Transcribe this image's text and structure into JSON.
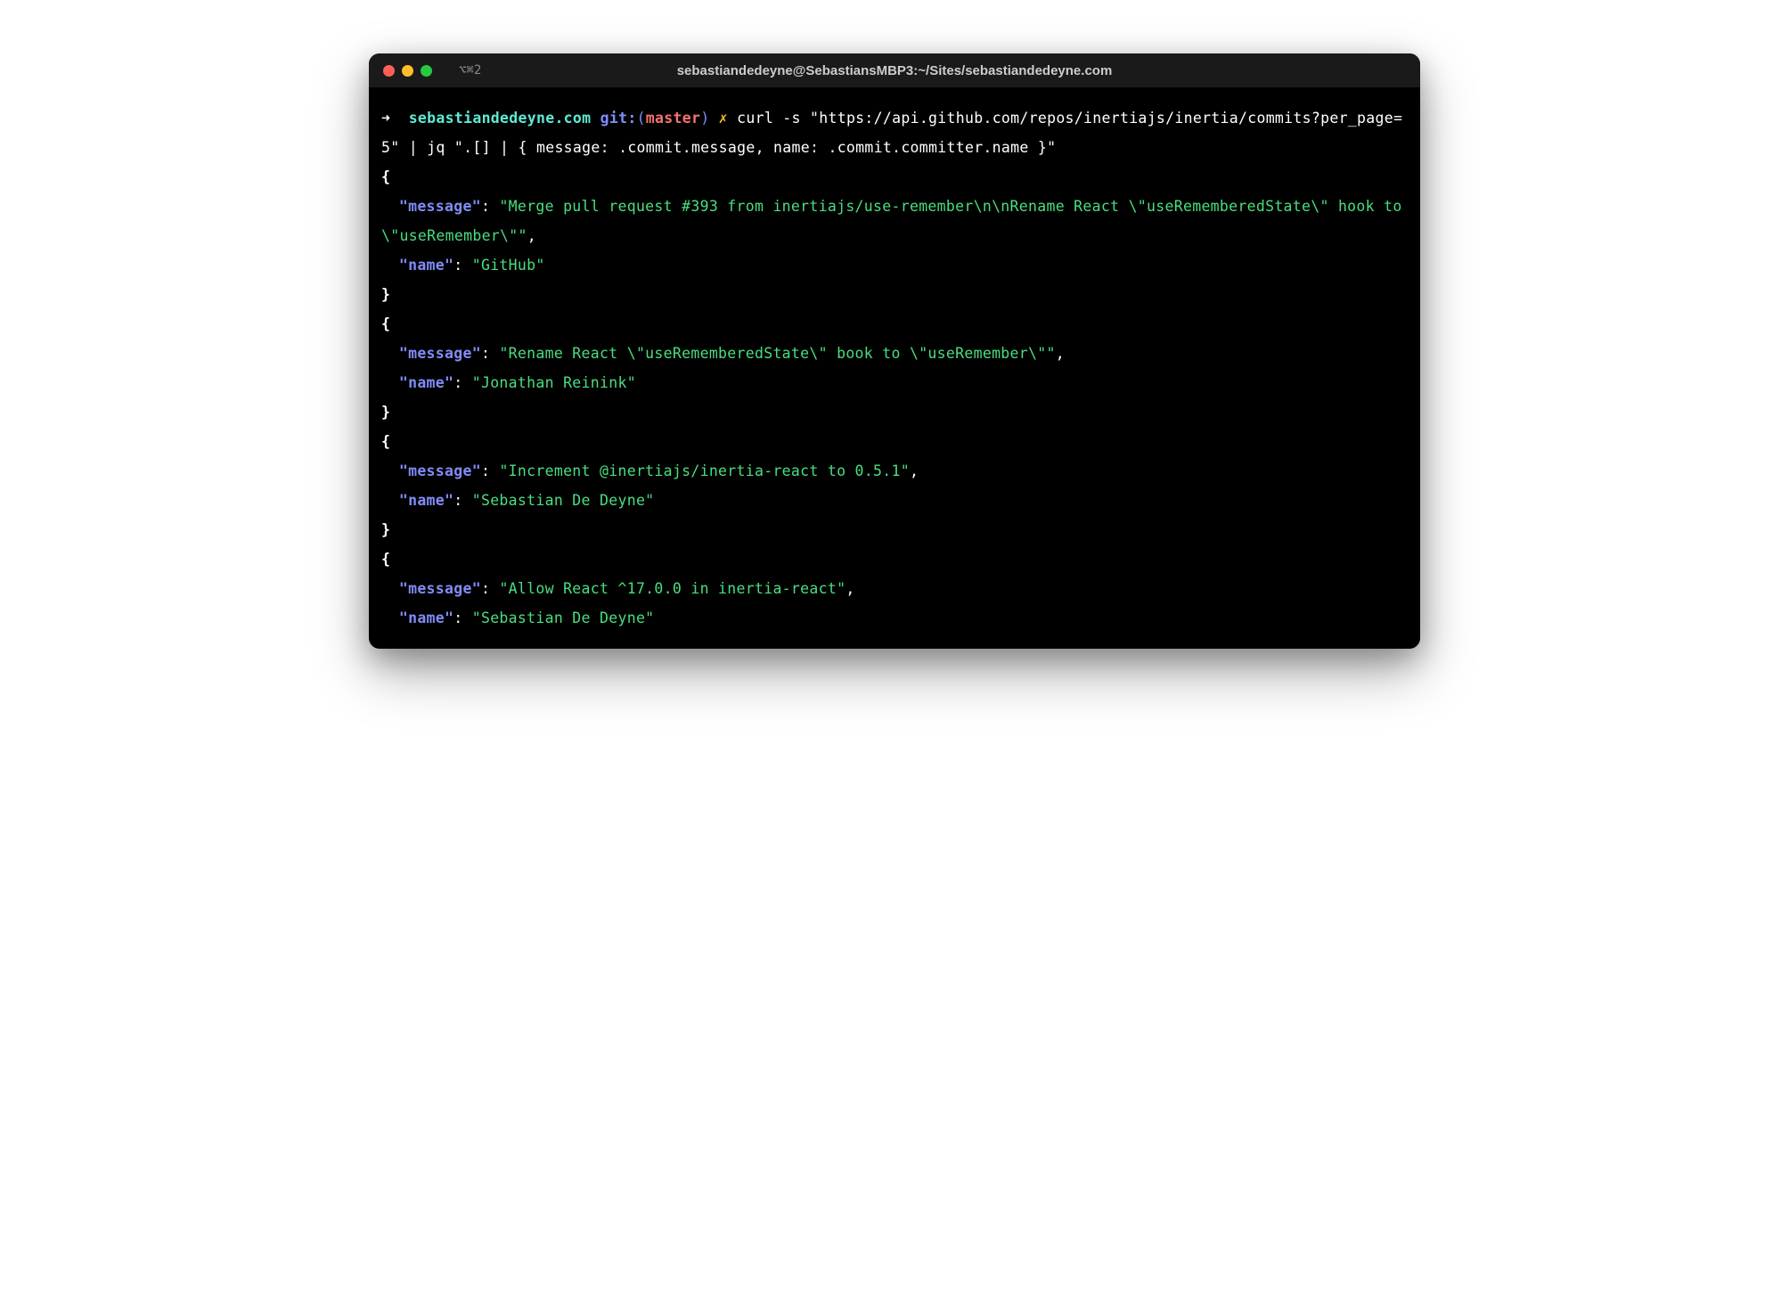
{
  "titlebar": {
    "tab_indicator": "⌥⌘2",
    "title": "sebastiandedeyne@SebastiansMBP3:~/Sites/sebastiandedeyne.com"
  },
  "prompt": {
    "arrow": "➜",
    "cwd": "sebastiandedeyne.com",
    "git_label": "git:",
    "git_open": "(",
    "git_branch": "master",
    "git_close": ")",
    "cross": "✗",
    "command": "curl -s \"https://api.github.com/repos/inertiajs/inertia/commits?per_page=5\" | jq \".[] | { message: .commit.message, name: .commit.committer.name }\""
  },
  "output": [
    {
      "message": "\"Merge pull request #393 from inertiajs/use-remember\\n\\nRename React \\\"useRememberedState\\\" hook to \\\"useRemember\\\"\"",
      "name": "\"GitHub\""
    },
    {
      "message": "\"Rename React \\\"useRememberedState\\\" book to \\\"useRemember\\\"\"",
      "name": "\"Jonathan Reinink\""
    },
    {
      "message": "\"Increment @inertiajs/inertia-react to 0.5.1\"",
      "name": "\"Sebastian De Deyne\""
    },
    {
      "message": "\"Allow React ^17.0.0 in inertia-react\"",
      "name": "\"Sebastian De Deyne\""
    }
  ],
  "key_labels": {
    "message": "\"message\"",
    "name": "\"name\""
  }
}
